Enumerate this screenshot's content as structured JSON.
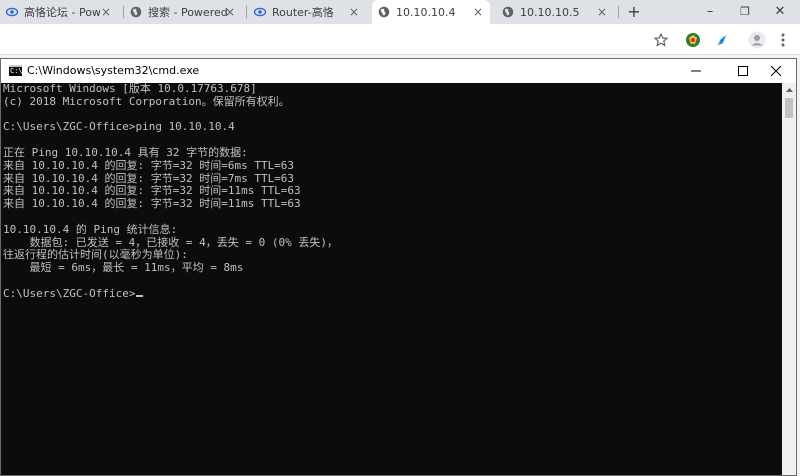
{
  "browser": {
    "tabs": [
      {
        "title": "高恪论坛 - Pow",
        "icon": "gaoke-eye-icon"
      },
      {
        "title": "搜索 - Powered",
        "icon": "globe-icon"
      },
      {
        "title": "Router-高恪",
        "icon": "gaoke-eye-icon"
      },
      {
        "title": "10.10.10.4",
        "icon": "globe-icon",
        "active": true
      },
      {
        "title": "10.10.10.5",
        "icon": "globe-icon"
      }
    ],
    "new_tab_label": "+",
    "window_controls": {
      "minimize": "–",
      "maximize": "❐",
      "close": "✕"
    }
  },
  "cmd": {
    "title": "C:\\Windows\\system32\\cmd.exe",
    "icon_text": "C:\\",
    "lines": [
      "Microsoft Windows [版本 10.0.17763.678]",
      "(c) 2018 Microsoft Corporation。保留所有权利。",
      "",
      "C:\\Users\\ZGC-Office>ping 10.10.10.4",
      "",
      "正在 Ping 10.10.10.4 具有 32 字节的数据:",
      "来自 10.10.10.4 的回复: 字节=32 时间=6ms TTL=63",
      "来自 10.10.10.4 的回复: 字节=32 时间=7ms TTL=63",
      "来自 10.10.10.4 的回复: 字节=32 时间=11ms TTL=63",
      "来自 10.10.10.4 的回复: 字节=32 时间=11ms TTL=63",
      "",
      "10.10.10.4 的 Ping 统计信息:",
      "    数据包: 已发送 = 4，已接收 = 4，丢失 = 0 (0% 丢失)，",
      "往返行程的估计时间(以毫秒为单位):",
      "    最短 = 6ms，最长 = 11ms，平均 = 8ms",
      ""
    ],
    "prompt": "C:\\Users\\ZGC-Office>"
  },
  "colors": {
    "console_bg": "#0c0c0c",
    "console_text": "#c0c0c0",
    "tabstrip_bg": "#dee1e6",
    "gaoke_icon": "#2b6cd4"
  }
}
